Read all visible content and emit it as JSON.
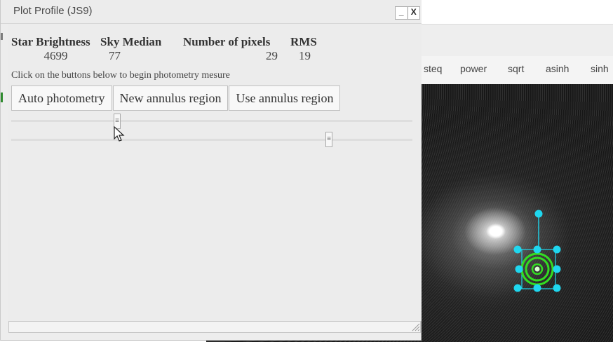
{
  "dialog": {
    "title": "Plot Profile (JS9)",
    "minimize_label": "_",
    "close_label": "X"
  },
  "stats": {
    "headers": [
      "Star Brightness",
      "Sky Median",
      "Number of pixels",
      "RMS"
    ],
    "values": [
      "4699",
      "77",
      "29",
      "19"
    ]
  },
  "instructions": "Click on the buttons below to begin photometry mesure",
  "buttons": {
    "auto": "Auto photometry",
    "new_annulus": "New annulus region",
    "use_annulus": "Use annulus region"
  },
  "slider_handle_glyph": "≡",
  "background_app": {
    "scale_menu": [
      "steq",
      "power",
      "sqrt",
      "asinh",
      "sinh"
    ]
  },
  "colors": {
    "region": "#1fd7ef",
    "aperture": "#33dd22"
  }
}
